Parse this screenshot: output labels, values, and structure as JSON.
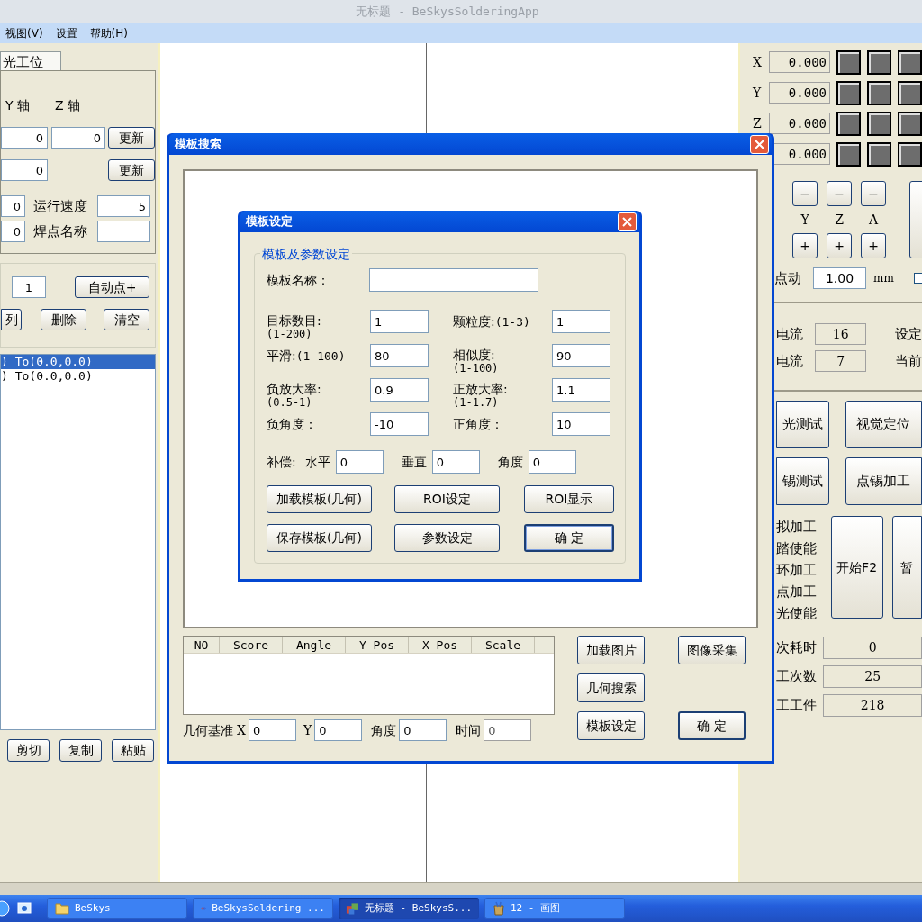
{
  "window": {
    "title": "无标题 - BeSkysSolderingApp"
  },
  "menu": [
    "视图(V)",
    "设置",
    "帮助(H)"
  ],
  "left_panel": {
    "tab": "光工位",
    "axis_headers": [
      "Y 轴",
      "Z 轴"
    ],
    "position_rows": [
      {
        "values": [
          "0",
          "0"
        ],
        "button": "更新"
      },
      {
        "values": [
          "0"
        ],
        "button": "更新"
      }
    ],
    "param_rows": [
      {
        "value": "0",
        "label": "运行速度",
        "field": "5"
      },
      {
        "value": "0",
        "label": "焊点名称"
      }
    ],
    "point_count": "1",
    "auto_button": "自动点+",
    "list_buttons": [
      "列",
      "删除",
      "清空"
    ],
    "points": [
      {
        "text": ") To(0.0,0.0)",
        "selected": true
      },
      {
        "text": ") To(0.0,0.0)",
        "selected": false
      }
    ],
    "edit_buttons": [
      "剪切",
      "复制",
      "粘贴"
    ]
  },
  "right_panel": {
    "axes": [
      {
        "label": "X",
        "value": "0.000"
      },
      {
        "label": "Y",
        "value": "0.000"
      },
      {
        "label": "Z",
        "value": "0.000"
      },
      {
        "value": "0.000"
      }
    ],
    "jog": {
      "minus": [
        "−",
        "−",
        "−"
      ],
      "axis_labels": [
        "Y",
        "Z",
        "A"
      ],
      "plus": [
        "+",
        "+",
        "+"
      ]
    },
    "step": {
      "label": "点动",
      "value": "1.00",
      "unit": "mm",
      "checked": false
    },
    "currents": [
      {
        "label": "电流",
        "value": "16",
        "note": "设定"
      },
      {
        "label": "电流",
        "value": "7",
        "note": "当前"
      }
    ],
    "action_buttons": [
      [
        "光测试",
        "视觉定位"
      ],
      [
        "锡测试",
        "点锡加工"
      ]
    ],
    "options": [
      "拟加工",
      "踏使能",
      "环加工",
      "点加工",
      "光使能"
    ],
    "start_buttons": [
      "开始F2",
      "暂"
    ],
    "stats": [
      {
        "label": "次耗时",
        "value": "0"
      },
      {
        "label": "工次数",
        "value": "25"
      },
      {
        "label": "工工件",
        "value": "218"
      }
    ]
  },
  "search_dialog": {
    "title": "模板搜索",
    "columns": [
      "NO",
      "Score",
      "Angle",
      "Y Pos",
      "X Pos",
      "Scale"
    ],
    "baseline": {
      "label": "几何基准",
      "fields": [
        {
          "label": "X",
          "value": "0",
          "disabled": false
        },
        {
          "label": "Y",
          "value": "0",
          "disabled": false
        },
        {
          "label": "角度",
          "value": "0",
          "disabled": false
        },
        {
          "label": "时间",
          "value": "0",
          "disabled": true
        }
      ]
    },
    "buttons": [
      [
        "加载图片",
        "图像采集"
      ],
      [
        "几何搜索"
      ],
      [
        "模板设定",
        "确 定"
      ]
    ]
  },
  "template_dialog": {
    "title": "模板设定",
    "group": "模板及参数设定",
    "name_label": "模板名称：",
    "params": [
      [
        {
          "kind": "stacked",
          "label": "目标数目:",
          "range": "(1-200)",
          "value": "1"
        },
        {
          "kind": "inline",
          "label": "颗粒度:",
          "range": "(1-3)",
          "value": "1"
        }
      ],
      [
        {
          "kind": "inline",
          "label": "平滑:",
          "range": "(1-100)",
          "value": "80"
        },
        {
          "kind": "stacked",
          "label": "相似度:",
          "range": "(1-100)",
          "value": "90"
        }
      ],
      [
        {
          "kind": "stacked",
          "label": "负放大率:",
          "range": "(0.5-1)",
          "value": "0.9"
        },
        {
          "kind": "stacked",
          "label": "正放大率:",
          "range": "(1-1.7)",
          "value": "1.1"
        }
      ],
      [
        {
          "kind": "inline",
          "label": "负角度：",
          "value": "-10"
        },
        {
          "kind": "inline",
          "label": "正角度：",
          "value": "10"
        }
      ]
    ],
    "compensation": {
      "label": "补偿:",
      "fields": [
        {
          "label": "水平",
          "value": "0"
        },
        {
          "label": "垂直",
          "value": "0"
        },
        {
          "label": "角度",
          "value": "0"
        }
      ]
    },
    "buttons": [
      [
        {
          "label": "加载模板(几何)",
          "default": false
        },
        {
          "label": "ROI设定",
          "default": false
        },
        {
          "label": "ROI显示",
          "default": false
        }
      ],
      [
        {
          "label": "保存模板(几何)",
          "default": false
        },
        {
          "label": "参数设定",
          "default": false
        },
        {
          "label": "确 定",
          "default": true
        }
      ]
    ]
  },
  "taskbar": {
    "tasks": [
      {
        "kind": "folder",
        "label": "BeSkys",
        "selected": false
      },
      {
        "kind": "link",
        "label": "BeSkysSoldering ...",
        "selected": false
      },
      {
        "kind": "app",
        "label": "无标题 - BeSkysS...",
        "selected": true
      },
      {
        "kind": "paint",
        "label": "12 - 画图",
        "selected": false
      }
    ]
  }
}
